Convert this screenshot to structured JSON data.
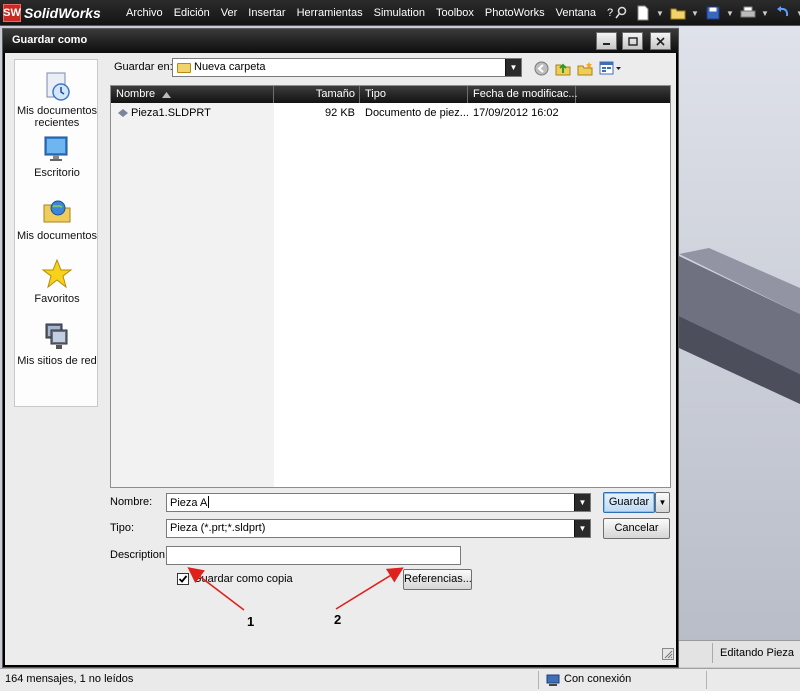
{
  "app": {
    "logo_mark": "SW",
    "logo_name": "SolidWorks",
    "menu": [
      "Archivo",
      "Edición",
      "Ver",
      "Insertar",
      "Herramientas",
      "Simulation",
      "Toolbox",
      "PhotoWorks",
      "Ventana",
      "?"
    ]
  },
  "dialog": {
    "title": "Guardar como",
    "save_in_label": "Guardar en:",
    "save_in_value": "Nueva carpeta",
    "places": [
      {
        "label": "Mis documentos recientes",
        "icon": "recent-documents-icon"
      },
      {
        "label": "Escritorio",
        "icon": "desktop-icon"
      },
      {
        "label": "Mis documentos",
        "icon": "my-documents-icon"
      },
      {
        "label": "Favoritos",
        "icon": "favorites-star-icon"
      },
      {
        "label": "Mis sitios de red",
        "icon": "network-places-icon"
      }
    ],
    "columns": [
      "Nombre",
      "Tamaño",
      "Tipo",
      "Fecha de modificac..."
    ],
    "files": [
      {
        "name": "Pieza1.SLDPRT",
        "size": "92 KB",
        "type": "Documento de piez...",
        "date": "17/09/2012 16:02"
      }
    ],
    "name_label": "Nombre:",
    "name_value": "Pieza A",
    "type_label": "Tipo:",
    "type_value": "Pieza (*.prt;*.sldprt)",
    "description_label": "Description:",
    "description_value": "",
    "save_copy_label": "Guardar como copia",
    "save_copy_checked": true,
    "references_button": "Referencias...",
    "save_button": "Guardar",
    "cancel_button": "Cancelar",
    "annotation_1": "1",
    "annotation_2": "2"
  },
  "status": {
    "messages": "164 mensajes, 1 no leídos",
    "connection": "Con conexión",
    "mode": "Editando Pieza"
  },
  "colors": {
    "annotation_arrow": "#e0201c",
    "dark_chrome": "#141414",
    "dialog_body": "#ececec"
  }
}
